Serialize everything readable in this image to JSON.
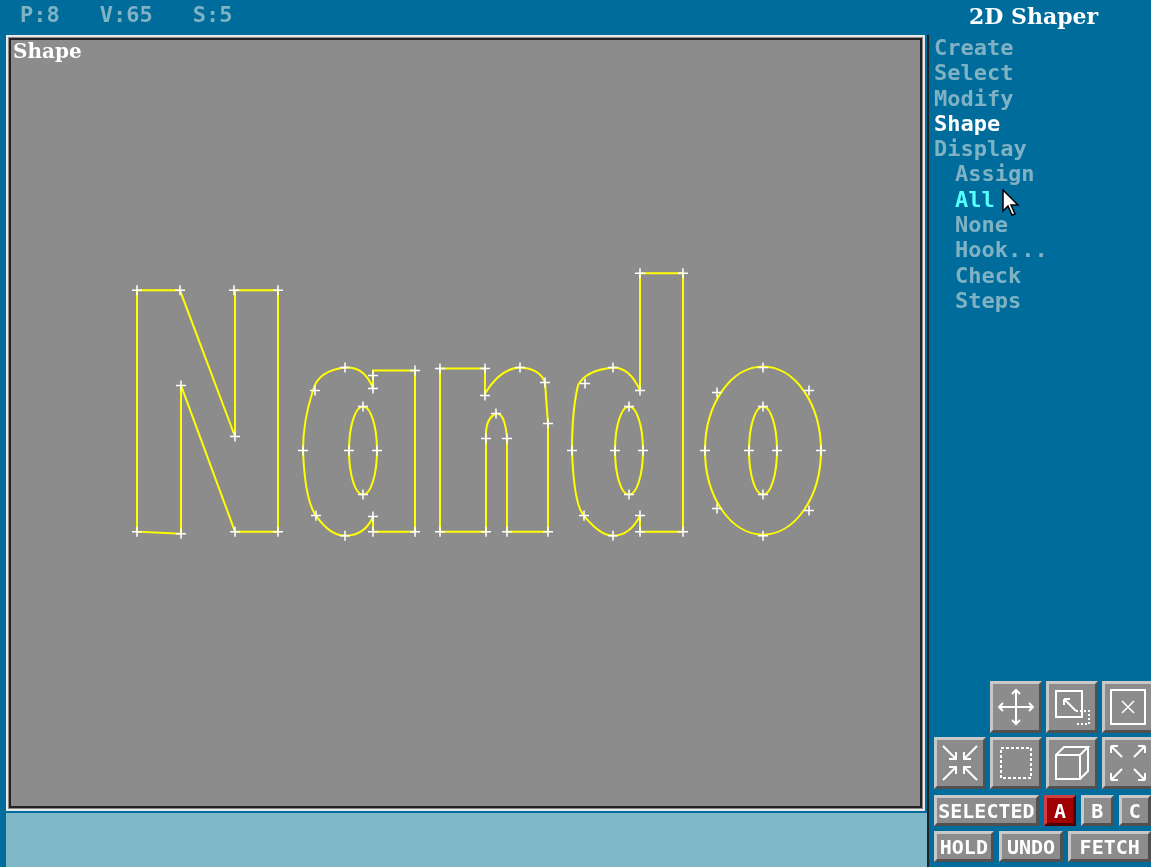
{
  "readouts": [
    "P:8",
    "V:65",
    "S:5"
  ],
  "viewport": {
    "label": "Shape"
  },
  "panel": {
    "title": "2D Shaper",
    "menu": [
      {
        "label": "Create",
        "selected": false
      },
      {
        "label": "Select",
        "selected": false
      },
      {
        "label": "Modify",
        "selected": false
      },
      {
        "label": "Shape",
        "selected": true
      },
      {
        "label": "Display",
        "selected": false
      }
    ],
    "submenu": [
      {
        "label": "Assign",
        "selected": false
      },
      {
        "label": "All",
        "selected": true
      },
      {
        "label": "None",
        "selected": false
      },
      {
        "label": "Hook...",
        "selected": false
      },
      {
        "label": "Check",
        "selected": false
      },
      {
        "label": "Steps",
        "selected": false
      }
    ]
  },
  "selection": {
    "label": "SELECTED",
    "sets": [
      {
        "label": "A",
        "selected": true
      },
      {
        "label": "B",
        "selected": false
      },
      {
        "label": "C",
        "selected": false
      }
    ]
  },
  "actions": [
    "HOLD",
    "UNDO",
    "FETCH"
  ]
}
